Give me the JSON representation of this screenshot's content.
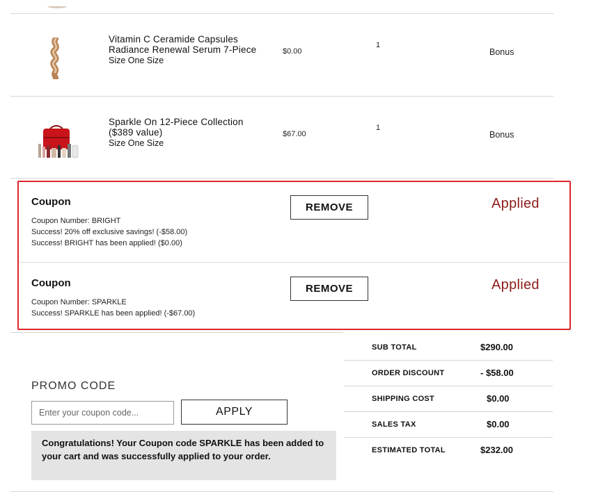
{
  "products": [
    {
      "name": "Vitamin C Ceramide Capsules Radiance Renewal Serum 7-Piece",
      "size": "Size One Size",
      "price": "$0.00",
      "qty": "1",
      "status": "Bonus",
      "image_icon": "serum-capsules-product-image"
    },
    {
      "name": "Sparkle On 12-Piece Collection ($389 value)",
      "size": "Size One Size",
      "price": "$67.00",
      "qty": "1",
      "status": "Bonus",
      "image_icon": "red-vanity-case-product-image"
    }
  ],
  "coupons": [
    {
      "title": "Coupon",
      "lines": [
        "Coupon Number: BRIGHT",
        "Success! 20% off exclusive savings! (-$58.00)",
        "Success! BRIGHT has been applied! ($0.00)"
      ],
      "remove_label": "REMOVE",
      "status": "Applied"
    },
    {
      "title": "Coupon",
      "lines": [
        "Coupon Number: SPARKLE",
        "Success! SPARKLE has been applied! (-$67.00)"
      ],
      "remove_label": "REMOVE",
      "status": "Applied"
    }
  ],
  "promo": {
    "label": "PROMO CODE",
    "placeholder": "Enter your coupon code...",
    "apply_label": "APPLY",
    "message": "Congratulations! Your Coupon code SPARKLE has been added to your cart and was successfully applied to your order."
  },
  "summary": [
    {
      "label": "SUB TOTAL",
      "value": "$290.00"
    },
    {
      "label": "ORDER DISCOUNT",
      "value": "- $58.00"
    },
    {
      "label": "SHIPPING COST",
      "value": "$0.00"
    },
    {
      "label": "SALES TAX",
      "value": "$0.00"
    },
    {
      "label": "ESTIMATED TOTAL",
      "value": "$232.00"
    }
  ],
  "colors": {
    "highlight_border": "#e0262a",
    "applied_text": "#8e1b1b",
    "message_bg": "#e4e4e4"
  }
}
